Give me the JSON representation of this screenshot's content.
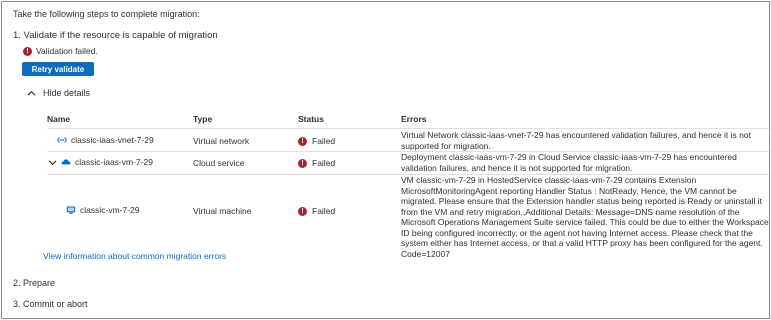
{
  "intro": "Take the following steps to complete migration:",
  "step1": "1. Validate if the resource is capable of migration",
  "validation_message": "Validation failed.",
  "retry_button": "Retry validate",
  "hide_details": "Hide details",
  "columns": {
    "name": "Name",
    "type": "Type",
    "status": "Status",
    "errors": "Errors"
  },
  "rows": [
    {
      "name": "classic-iaas-vnet-7-29",
      "icon": "virtual-network-icon",
      "type": "Virtual network",
      "status": "Failed",
      "errors": "Virtual Network classic-iaas-vnet-7-29 has encountered validation failures, and hence it is not supported for migration."
    },
    {
      "name": "classic-iaas-vm-7-29",
      "icon": "cloud-service-icon",
      "type": "Cloud service",
      "status": "Failed",
      "errors": "Deployment classic-iaas-vm-7-29 in Cloud Service classic-iaas-vm-7-29 has encountered validation failures, and hence it is not supported for migration."
    },
    {
      "name": "classic-vm-7-29",
      "icon": "virtual-machine-icon",
      "type": "Virtual machine",
      "status": "Failed",
      "errors": "VM classic-vm-7-29 in HostedService classic-iaas-vm-7-29 contains Extension MicrosoftMonitoringAgent reporting Handler Status : NotReady. Hence, the VM cannot be migrated. Please ensure that the Extension handler status being reported is Ready or uninstall it from the VM and retry migration.,Additional Details: Message=DNS name resolution of the Microsoft Operations Management Suite service failed. This could be due to either the Workspace ID being configured incorrectly, or the agent not having Internet access. Please check that the system either has Internet access, or that a valid HTTP proxy has been configured for the agent. Code=12007"
    }
  ],
  "link": "View information about common migration errors",
  "step2": "2. Prepare",
  "step3": "3. Commit or abort",
  "colors": {
    "accent": "#0f6cbd",
    "error": "#a4262c",
    "border": "#e1dfdd"
  }
}
